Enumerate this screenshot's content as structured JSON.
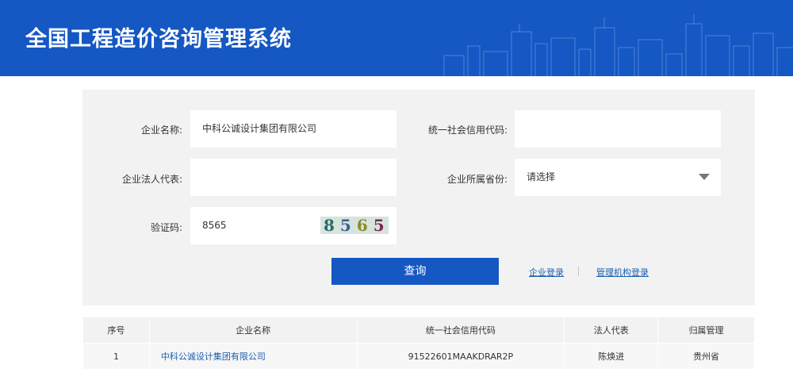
{
  "header": {
    "title": "全国工程造价咨询管理系统"
  },
  "form": {
    "company_name": {
      "label": "企业名称:",
      "value": "中科公诚设计集团有限公司"
    },
    "credit_code": {
      "label": "统一社会信用代码:",
      "value": ""
    },
    "legal_rep": {
      "label": "企业法人代表:",
      "value": ""
    },
    "province": {
      "label": "企业所属省份:",
      "value": "请选择"
    },
    "captcha": {
      "label": "验证码:",
      "value": "8565",
      "image_digits": [
        "8",
        "5",
        "6",
        "5"
      ]
    }
  },
  "actions": {
    "search_label": "查询",
    "enterprise_login": "企业登录",
    "agency_login": "管理机构登录"
  },
  "table": {
    "headers": [
      "序号",
      "企业名称",
      "统一社会信用代码",
      "法人代表",
      "归属管理"
    ],
    "rows": [
      [
        "1",
        "中科公诚设计集团有限公司",
        "91522601MAAKDRAR2P",
        "陈焕进",
        "贵州省"
      ]
    ]
  },
  "colors": {
    "brand_blue": "#1557c3",
    "link_blue": "#1a5fae",
    "panel_bg": "#f2f2f2"
  }
}
